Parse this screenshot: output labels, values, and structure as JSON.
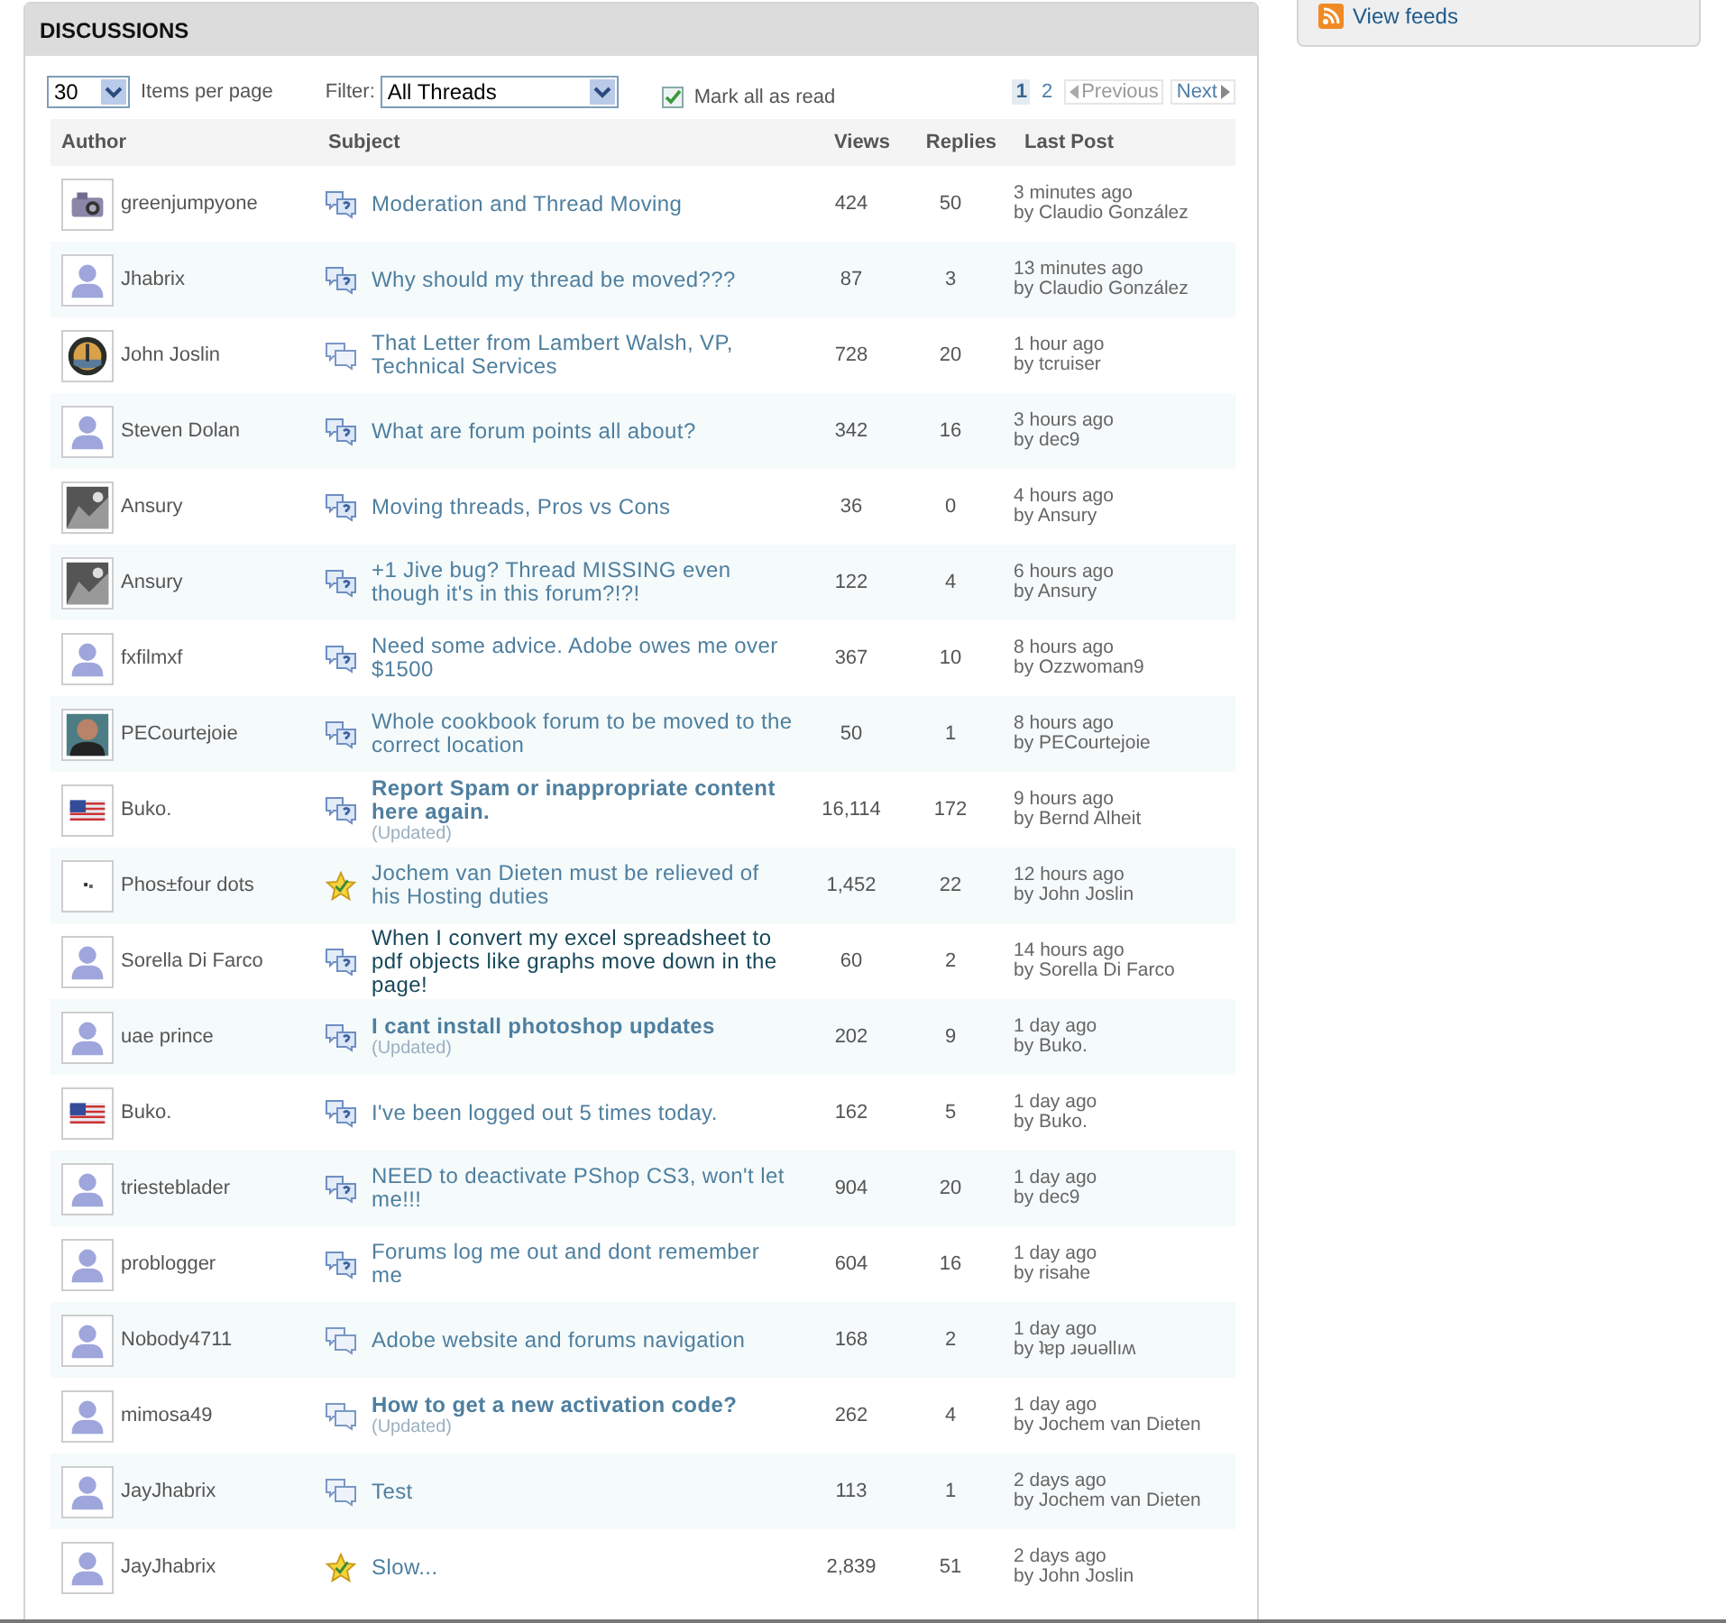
{
  "panel": {
    "title": "DISCUSSIONS"
  },
  "sidebar": {
    "link": "View feeds"
  },
  "toolbar": {
    "per_page": "30",
    "per_page_label": "Items per page",
    "filter_label": "Filter:",
    "filter": "All Threads",
    "mark_read": {
      "label": "Mark all as read",
      "checked": true
    }
  },
  "pagination": {
    "pages": [
      {
        "label": "1",
        "selected": true
      },
      {
        "label": "2",
        "selected": false
      }
    ],
    "previous": {
      "label": "Previous",
      "disabled": true
    },
    "next": {
      "label": "Next",
      "disabled": false
    }
  },
  "columns": [
    "Author",
    "Subject",
    "Views",
    "Replies",
    "Last Post"
  ],
  "rows": [
    {
      "avatar": {
        "kind": "camera"
      },
      "author": "greenjumpyone",
      "kind": "question",
      "subject": {
        "text": "Moderation and Thread Moving",
        "kind": "normal"
      },
      "views": "424",
      "replies": "50",
      "time": "3 minutes ago",
      "by": "by Claudio González"
    },
    {
      "avatar": {
        "kind": "person"
      },
      "author": "Jhabrix",
      "kind": "question",
      "subject": {
        "text": "Why should my thread be moved???",
        "kind": "normal"
      },
      "views": "87",
      "replies": "3",
      "time": "13 minutes ago",
      "by": "by Claudio González"
    },
    {
      "avatar": {
        "kind": "globe"
      },
      "author": "John Joslin",
      "kind": "discussion",
      "subject": {
        "text": "That Letter from Lambert Walsh, VP, Technical Services",
        "kind": "normal"
      },
      "views": "728",
      "replies": "20",
      "time": "1 hour ago",
      "by": "by tcruiser"
    },
    {
      "avatar": {
        "kind": "person"
      },
      "author": "Steven Dolan",
      "kind": "question",
      "subject": {
        "text": "What are forum points all about?",
        "kind": "normal"
      },
      "views": "342",
      "replies": "16",
      "time": "3 hours ago",
      "by": "by dec9"
    },
    {
      "avatar": {
        "kind": "photo"
      },
      "author": "Ansury",
      "kind": "question",
      "subject": {
        "text": "Moving threads, Pros vs Cons",
        "kind": "normal"
      },
      "views": "36",
      "replies": "0",
      "time": "4 hours ago",
      "by": "by Ansury"
    },
    {
      "avatar": {
        "kind": "photo"
      },
      "author": "Ansury",
      "kind": "question",
      "subject": {
        "text": "+1 Jive bug? Thread MISSING even though it's in this forum?!?!",
        "kind": "normal"
      },
      "views": "122",
      "replies": "4",
      "time": "6 hours ago",
      "by": "by Ansury"
    },
    {
      "avatar": {
        "kind": "person"
      },
      "author": "fxfilmxf",
      "kind": "question",
      "subject": {
        "text": "Need some advice. Adobe owes me over $1500",
        "kind": "normal"
      },
      "views": "367",
      "replies": "10",
      "time": "8 hours ago",
      "by": "by Ozzwoman9"
    },
    {
      "avatar": {
        "kind": "portrait"
      },
      "author": "PECourtejoie",
      "kind": "question",
      "subject": {
        "text": "Whole cookbook forum to be moved to the correct location",
        "kind": "normal"
      },
      "views": "50",
      "replies": "1",
      "time": "8 hours ago",
      "by": "by PECourtejoie"
    },
    {
      "avatar": {
        "kind": "flag"
      },
      "author": "Buko.",
      "kind": "question",
      "subject": {
        "text": "Report Spam or inappropriate content here again.",
        "kind": "bold",
        "updated": "(Updated)"
      },
      "views": "16,114",
      "replies": "172",
      "time": "9 hours ago",
      "by": "by Bernd Alheit"
    },
    {
      "avatar": {
        "kind": "dots"
      },
      "author": "Phos±four dots",
      "kind": "answered",
      "subject": {
        "text": "Jochem van Dieten must be relieved of his Hosting duties",
        "kind": "normal"
      },
      "views": "1,452",
      "replies": "22",
      "time": "12 hours ago",
      "by": "by John Joslin"
    },
    {
      "avatar": {
        "kind": "person"
      },
      "author": "Sorella Di Farco",
      "kind": "question",
      "subject": {
        "text": "When I convert my excel spreadsheet to pdf objects like graphs move down in the page!",
        "kind": "dark"
      },
      "views": "60",
      "replies": "2",
      "time": "14 hours ago",
      "by": "by Sorella Di Farco"
    },
    {
      "avatar": {
        "kind": "person"
      },
      "author": "uae prince",
      "kind": "question",
      "subject": {
        "text": "I cant install photoshop updates",
        "kind": "bold",
        "updated": "(Updated)"
      },
      "views": "202",
      "replies": "9",
      "time": "1 day ago",
      "by": "by Buko."
    },
    {
      "avatar": {
        "kind": "flag"
      },
      "author": "Buko.",
      "kind": "question",
      "subject": {
        "text": "I've been logged out 5 times today.",
        "kind": "normal"
      },
      "views": "162",
      "replies": "5",
      "time": "1 day ago",
      "by": "by Buko."
    },
    {
      "avatar": {
        "kind": "person"
      },
      "author": "triesteblader",
      "kind": "question",
      "subject": {
        "text": "NEED to deactivate PShop CS3, won't let me!!!",
        "kind": "normal"
      },
      "views": "904",
      "replies": "20",
      "time": "1 day ago",
      "by": "by dec9"
    },
    {
      "avatar": {
        "kind": "person"
      },
      "author": "problogger",
      "kind": "question",
      "subject": {
        "text": "Forums log me out and dont remember me",
        "kind": "normal"
      },
      "views": "604",
      "replies": "16",
      "time": "1 day ago",
      "by": "by risahe"
    },
    {
      "avatar": {
        "kind": "person"
      },
      "author": "Nobody4711",
      "kind": "discussion",
      "subject": {
        "text": "Adobe website and forums navigation",
        "kind": "normal"
      },
      "views": "168",
      "replies": "2",
      "time": "1 day ago",
      "by": "by ʇɐp ɹǝuǝllıʍ"
    },
    {
      "avatar": {
        "kind": "person"
      },
      "author": "mimosa49",
      "kind": "discussion",
      "subject": {
        "text": "How to get a new activation code?",
        "kind": "bold",
        "updated": "(Updated)"
      },
      "views": "262",
      "replies": "4",
      "time": "1 day ago",
      "by": "by Jochem van Dieten"
    },
    {
      "avatar": {
        "kind": "person"
      },
      "author": "JayJhabrix",
      "kind": "discussion",
      "subject": {
        "text": "Test",
        "kind": "normal"
      },
      "views": "113",
      "replies": "1",
      "time": "2 days ago",
      "by": "by Jochem van Dieten"
    },
    {
      "avatar": {
        "kind": "person"
      },
      "author": "JayJhabrix",
      "kind": "answered",
      "subject": {
        "text": "Slow...",
        "kind": "normal"
      },
      "views": "2,839",
      "replies": "51",
      "time": "2 days ago",
      "by": "by John Joslin"
    }
  ]
}
